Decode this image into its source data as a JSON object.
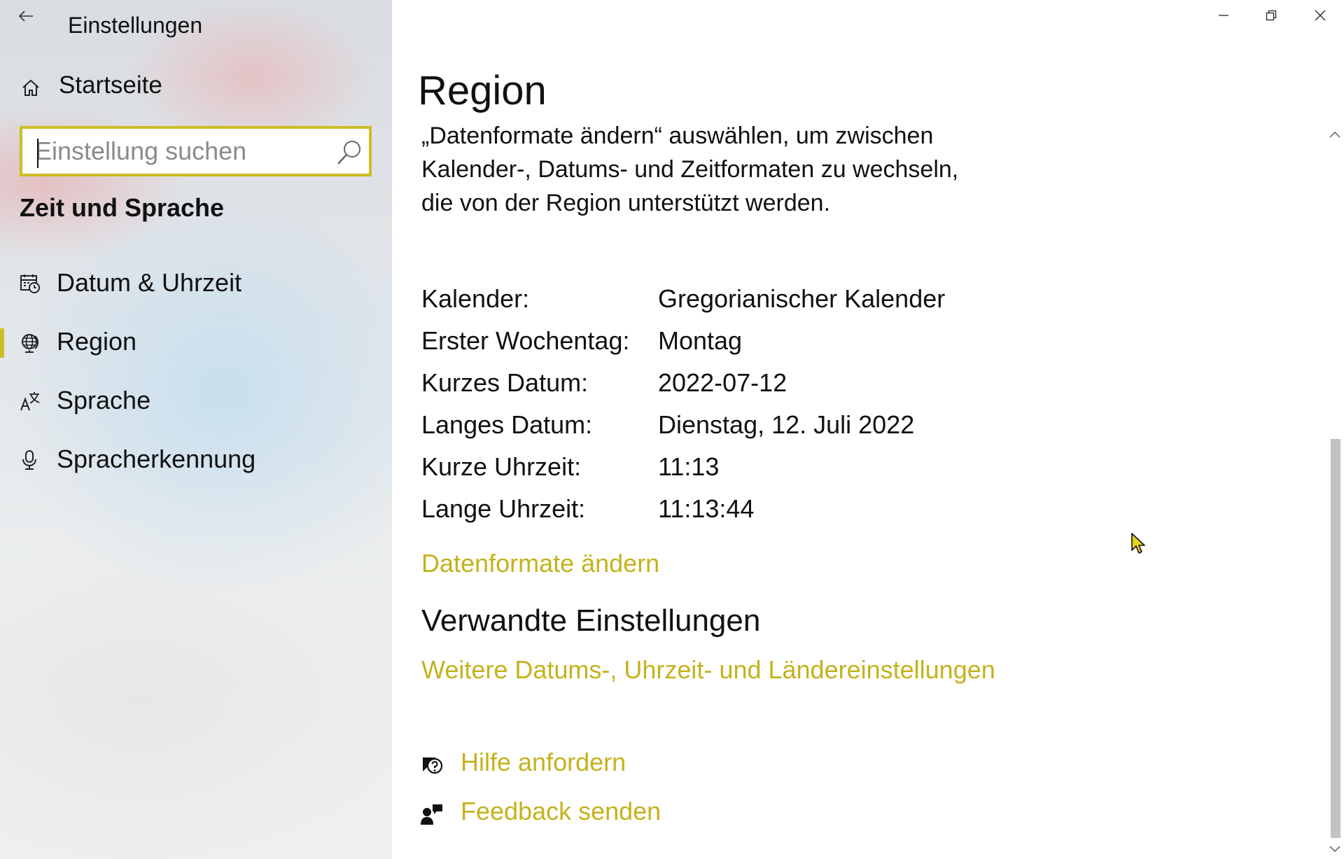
{
  "window": {
    "app_title": "Einstellungen",
    "controls": {
      "minimize": "minimize-icon",
      "restore": "restore-icon",
      "close": "close-icon"
    }
  },
  "sidebar": {
    "home_label": "Startseite",
    "search": {
      "placeholder": "Einstellung suchen",
      "value": ""
    },
    "section_heading": "Zeit und Sprache",
    "items": [
      {
        "label": "Datum & Uhrzeit",
        "icon": "calendar-clock-icon",
        "selected": false
      },
      {
        "label": "Region",
        "icon": "globe-icon",
        "selected": true
      },
      {
        "label": "Sprache",
        "icon": "language-icon",
        "selected": false
      },
      {
        "label": "Spracherkennung",
        "icon": "microphone-icon",
        "selected": false
      }
    ]
  },
  "main": {
    "title": "Region",
    "description": "„Datenformate ändern“ auswählen, um zwischen Kalender-, Datums- und Zeitformaten zu wechseln, die von der Region unterstützt werden.",
    "formats": [
      {
        "key": "Kalender:",
        "value": "Gregorianischer Kalender"
      },
      {
        "key": "Erster Wochentag:",
        "value": "Montag"
      },
      {
        "key": "Kurzes Datum:",
        "value": "2022-07-12"
      },
      {
        "key": "Langes Datum:",
        "value": "Dienstag, 12. Juli 2022"
      },
      {
        "key": "Kurze Uhrzeit:",
        "value": "11:13"
      },
      {
        "key": "Lange Uhrzeit:",
        "value": "11:13:44"
      }
    ],
    "change_formats_link": "Datenformate ändern",
    "related_heading": "Verwandte Einstellungen",
    "related_link": "Weitere Datums-, Uhrzeit- und Ländereinstellungen",
    "help_link": "Hilfe anfordern",
    "feedback_link": "Feedback senden"
  },
  "colors": {
    "accent": "#c4b21c",
    "focus_border": "#cdbd22",
    "scroll_thumb": "#c2c2c2"
  }
}
